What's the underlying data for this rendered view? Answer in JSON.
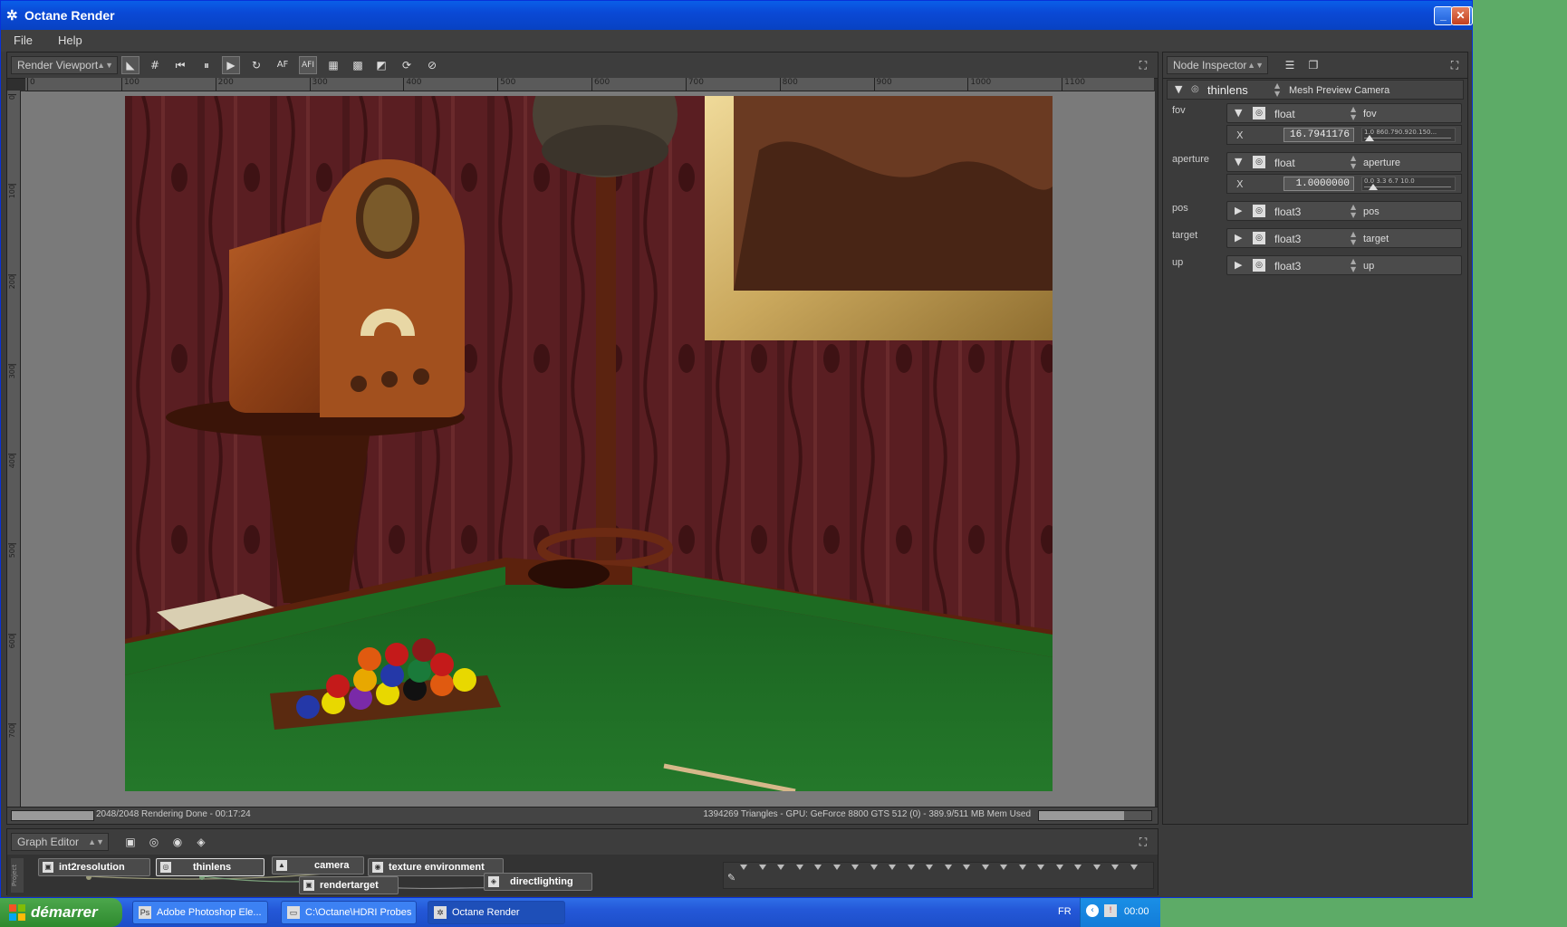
{
  "window": {
    "title": "Octane Render"
  },
  "menu": {
    "items": [
      "File",
      "Help"
    ]
  },
  "viewport": {
    "panel_label": "Render Viewport",
    "toolbar_buttons": [
      "select",
      "grid",
      "rewind",
      "pause",
      "play",
      "reload",
      "AF",
      "AFI",
      "region",
      "checker",
      "tiles",
      "rotate-a",
      "rotate-b"
    ],
    "ruler_top": [
      "0",
      "100",
      "200",
      "300",
      "400",
      "500",
      "600",
      "700",
      "800",
      "900",
      "1000",
      "1100"
    ],
    "ruler_left": [
      "0",
      "100",
      "200",
      "300",
      "400",
      "500",
      "600",
      "700"
    ],
    "status_left": "2048/2048 Rendering Done - 00:17:24",
    "status_right": "1394269 Triangles - GPU: GeForce 8800 GTS 512 (0) - 389.9/511 MB Mem Used",
    "progress": 1.0,
    "mem_progress": 0.76
  },
  "inspector": {
    "panel_label": "Node Inspector",
    "node_type": "thinlens",
    "node_name": "Mesh Preview Camera",
    "params": [
      {
        "label": "fov",
        "type": "float",
        "name": "fov",
        "value": "16.7941176",
        "slider_ticks": "1.0 860.790.920.150...",
        "slider_pos": 0.06
      },
      {
        "label": "aperture",
        "type": "float",
        "name": "aperture",
        "value": "1.0000000",
        "slider_ticks": "0.0     3.3     6.7     10.0",
        "slider_pos": 0.1
      },
      {
        "label": "pos",
        "type": "float3",
        "name": "pos"
      },
      {
        "label": "target",
        "type": "float3",
        "name": "target"
      },
      {
        "label": "up",
        "type": "float3",
        "name": "up"
      }
    ]
  },
  "graph": {
    "panel_label": "Graph Editor",
    "side_label": "Project",
    "nodes": [
      "int2resolution",
      "thinlens",
      "camera",
      "texture environment",
      "rendertarget",
      "directlighting"
    ]
  },
  "taskbar": {
    "start_label": "démarrer",
    "tasks": [
      "Adobe Photoshop Ele...",
      "C:\\Octane\\HDRI Probes",
      "Octane Render"
    ],
    "language": "FR",
    "clock": "00:00"
  },
  "colors": {
    "titlebar": "#0a49d6",
    "desktop": "#5dab67",
    "panel": "#3b3b3b",
    "felt": "#1f6e24",
    "wallpaper": "#5c1f22"
  }
}
